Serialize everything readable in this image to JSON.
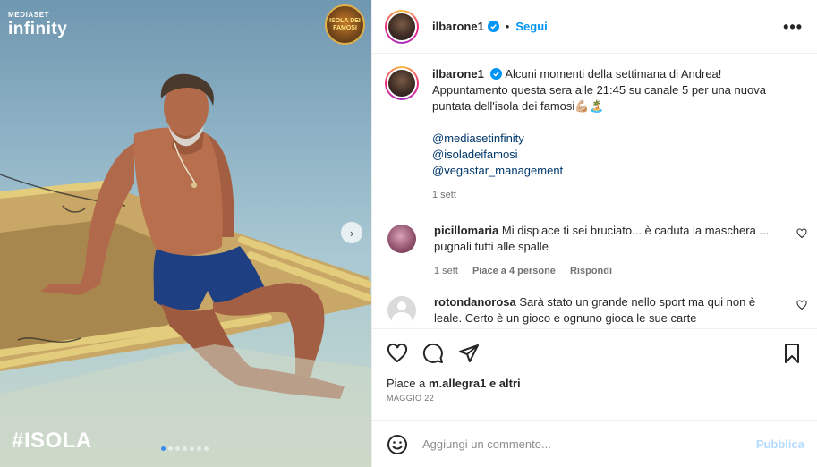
{
  "media": {
    "watermark_brand_small": "MEDIASET",
    "watermark_brand_big": "infinity",
    "show_logo_text": "ISOLA DEI FAMOSI",
    "hashtag": "#ISOLA",
    "carousel_slide_count": 7,
    "carousel_active_index": 0
  },
  "header": {
    "username": "ilbarone1",
    "separator": "•",
    "follow_label": "Segui",
    "more_label": "•••"
  },
  "caption": {
    "username": "ilbarone1",
    "text_line1": "Alcuni momenti della settimana di Andrea!",
    "text_line2": "Appuntamento questa sera alle 21:45 su canale 5 per una nuova",
    "text_line3": "puntata dell'isola dei famosi💪🏼🏝️",
    "mentions": [
      "@mediasetinfinity",
      "@isoladeifamosi",
      "@vegastar_management"
    ],
    "time": "1 sett"
  },
  "comments": [
    {
      "username": "picillomaria",
      "text_line1": "Mi dispiace ti sei bruciato... è caduta la maschera ...",
      "text_line2": "pugnali tutti alle spalle",
      "time": "1 sett",
      "likes": "Piace a 4 persone",
      "reply": "Rispondi"
    },
    {
      "username": "rotondanorosa",
      "text_line1": "Sarà stato un grande nello sport ma qui non è",
      "text_line2": "leale. Certo è un gioco e ognuno gioca le sue carte"
    }
  ],
  "actions": {
    "likes_prefix": "Piace a",
    "likes_user": "m.allegra1",
    "likes_suffix": "e altri",
    "date": "MAGGIO 22"
  },
  "composer": {
    "placeholder": "Aggiungi un commento...",
    "publish_label": "Pubblica"
  },
  "colors": {
    "accent": "#0095f6",
    "publish_disabled": "#b3dbff",
    "muted": "#737373"
  }
}
